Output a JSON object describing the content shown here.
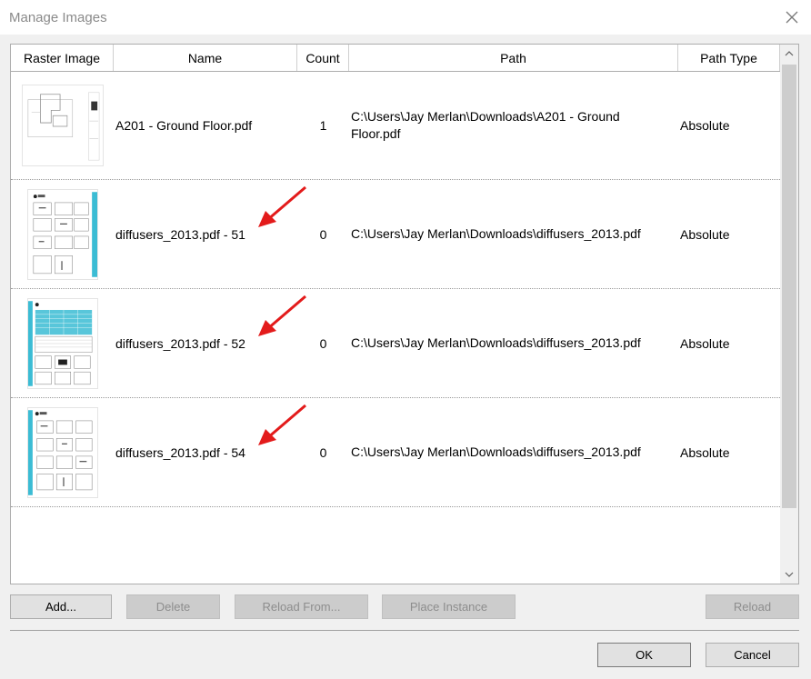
{
  "window": {
    "title": "Manage Images",
    "close_glyph": "close-icon"
  },
  "columns": {
    "raster_image": "Raster Image",
    "name": "Name",
    "count": "Count",
    "path": "Path",
    "path_type": "Path Type"
  },
  "rows": [
    {
      "thumbnail": "floor-plan-thumbnail",
      "name": "A201 - Ground Floor.pdf",
      "count": "1",
      "path": "C:\\Users\\Jay Merlan\\Downloads\\A201 - Ground Floor.pdf",
      "path_type": "Absolute"
    },
    {
      "thumbnail": "diffuser-sheet-thumbnail",
      "name": "diffusers_2013.pdf - 51",
      "count": "0",
      "path": "C:\\Users\\Jay Merlan\\Downloads\\diffusers_2013.pdf",
      "path_type": "Absolute"
    },
    {
      "thumbnail": "diffuser-table-thumbnail",
      "name": "diffusers_2013.pdf - 52",
      "count": "0",
      "path": "C:\\Users\\Jay Merlan\\Downloads\\diffusers_2013.pdf",
      "path_type": "Absolute"
    },
    {
      "thumbnail": "diffuser-sheet-thumbnail",
      "name": "diffusers_2013.pdf - 54",
      "count": "0",
      "path": "C:\\Users\\Jay Merlan\\Downloads\\diffusers_2013.pdf",
      "path_type": "Absolute"
    }
  ],
  "buttons": {
    "add": "Add...",
    "delete": "Delete",
    "reload_from": "Reload From...",
    "place_instance": "Place Instance",
    "reload": "Reload",
    "ok": "OK",
    "cancel": "Cancel"
  },
  "colors": {
    "annotation_arrow": "#e31b1b",
    "thumbnail_accent": "#3bbcd4"
  }
}
